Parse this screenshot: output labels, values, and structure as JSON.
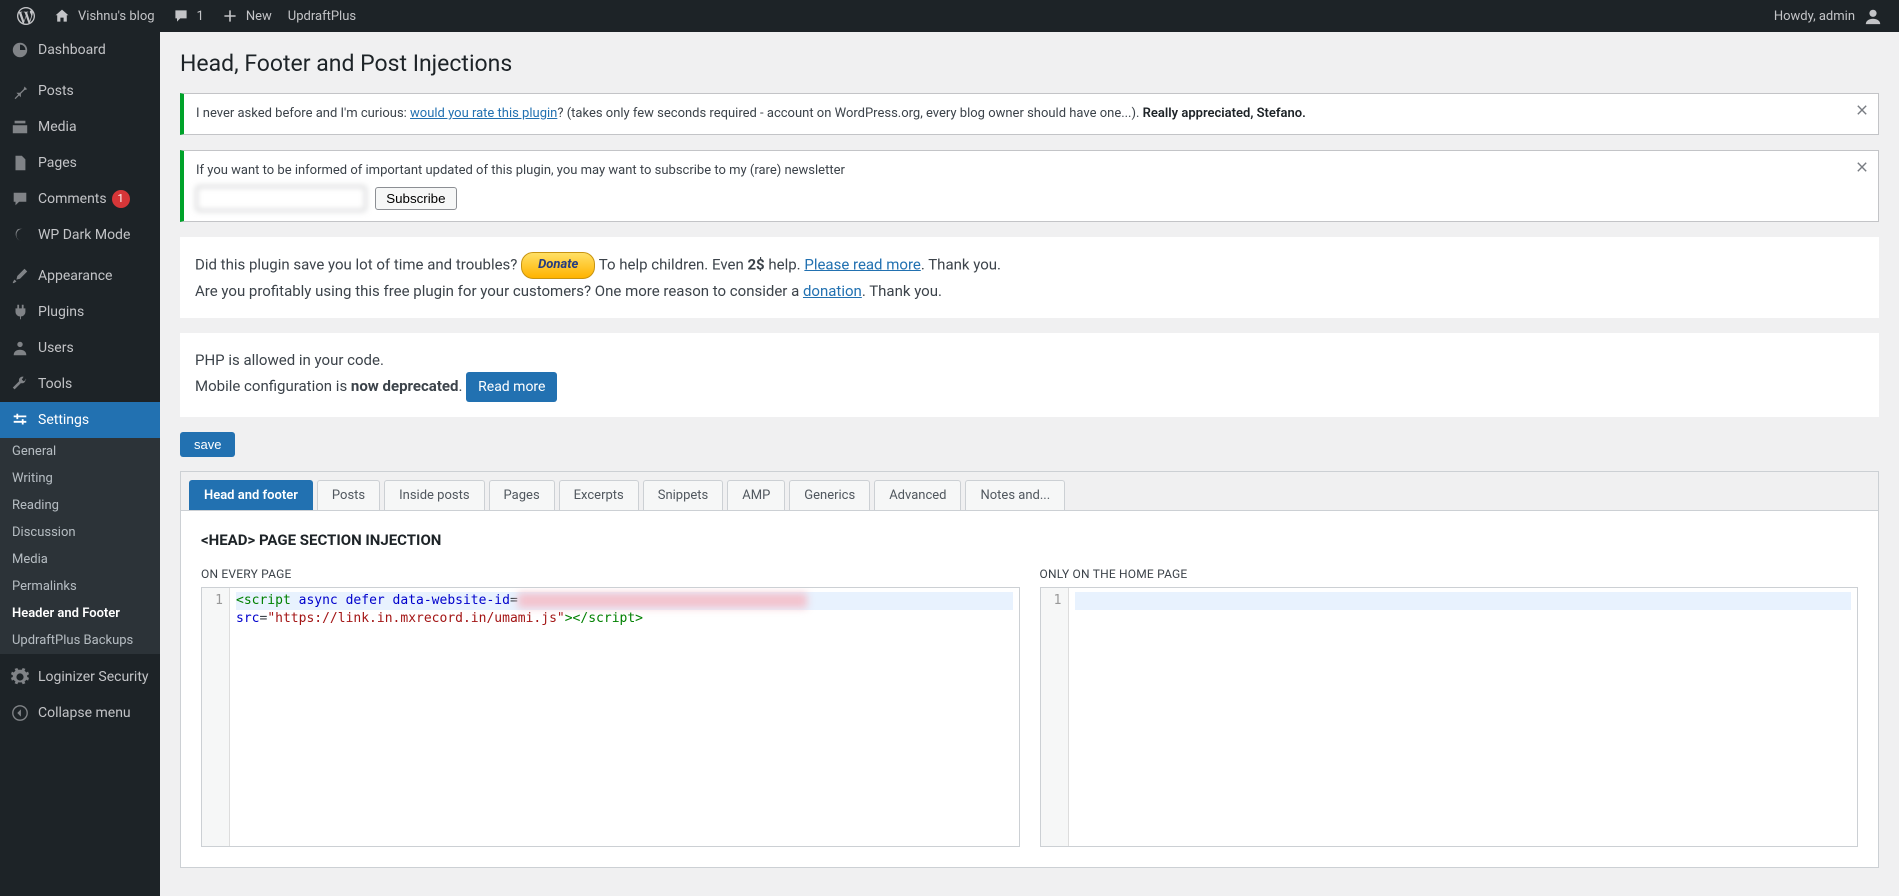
{
  "adminbar": {
    "site_name": "Vishnu's blog",
    "comments_count": "1",
    "new_label": "New",
    "updraft_label": "UpdraftPlus",
    "howdy": "Howdy, admin"
  },
  "sidebar": {
    "dashboard": "Dashboard",
    "posts": "Posts",
    "media": "Media",
    "pages": "Pages",
    "comments": "Comments",
    "comments_badge": "1",
    "wp_dark_mode": "WP Dark Mode",
    "appearance": "Appearance",
    "plugins": "Plugins",
    "users": "Users",
    "tools": "Tools",
    "settings": "Settings",
    "submenu": {
      "general": "General",
      "writing": "Writing",
      "reading": "Reading",
      "discussion": "Discussion",
      "media": "Media",
      "permalinks": "Permalinks",
      "header_footer": "Header and Footer",
      "updraft_backups": "UpdraftPlus Backups"
    },
    "loginizer": "Loginizer Security",
    "collapse": "Collapse menu"
  },
  "page": {
    "title": "Head, Footer and Post Injections",
    "notice1_pre": "I never asked before and I'm curious: ",
    "notice1_link": "would you rate this plugin",
    "notice1_post": "? (takes only few seconds required - account on WordPress.org, every blog owner should have one...). ",
    "notice1_strong": "Really appreciated, Stefano.",
    "notice2_text": "If you want to be informed of important updated of this plugin, you may want to subscribe to my (rare) newsletter",
    "notice2_subscribe": "Subscribe",
    "donate_pre": "Did this plugin save you lot of time and troubles? ",
    "donate_btn": "Donate",
    "donate_post1": " To help children. Even ",
    "donate_bold": "2$",
    "donate_post2": " help. ",
    "donate_link": "Please read more",
    "donate_post3": ". Thank you.",
    "donate_line2_pre": "Are you profitably using this free plugin for your customers? One more reason to consider a ",
    "donate_line2_link": "donation",
    "donate_line2_post": ". Thank you.",
    "php_line": "PHP is allowed in your code.",
    "deprecated_pre": "Mobile configuration is ",
    "deprecated_strong": "now deprecated",
    "deprecated_post": ". ",
    "read_more": "Read more",
    "save": "save",
    "tabs": [
      "Head and footer",
      "Posts",
      "Inside posts",
      "Pages",
      "Excerpts",
      "Snippets",
      "AMP",
      "Generics",
      "Advanced",
      "Notes and..."
    ],
    "section_title": "<HEAD> PAGE SECTION INJECTION",
    "every_page_label": "ON EVERY PAGE",
    "home_page_label": "ONLY ON THE HOME PAGE",
    "code_src": "\"https://link.in.mxrecord.in/umami.js\""
  }
}
